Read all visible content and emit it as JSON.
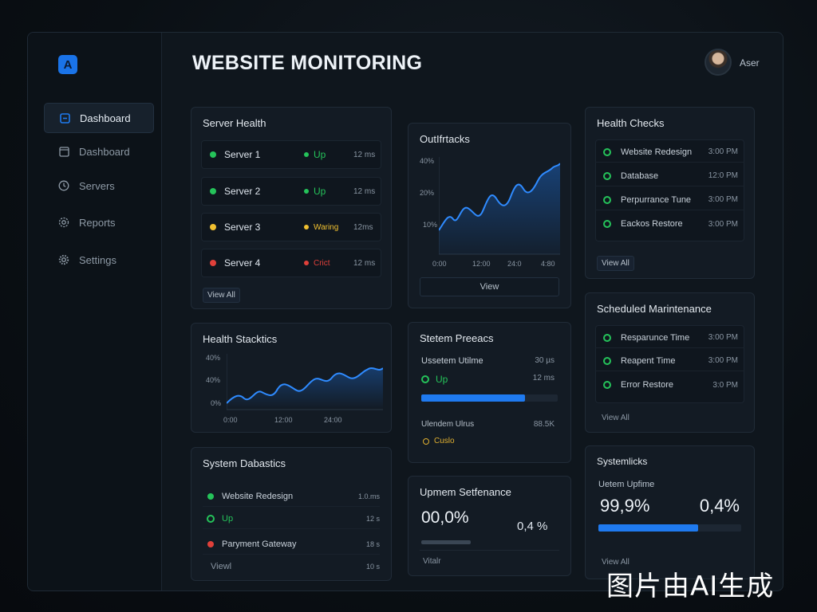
{
  "header": {
    "title": "WEBSITE MONITORING",
    "username": "Aser",
    "logo_letter": "A"
  },
  "sidebar": {
    "items": [
      {
        "label": "Dashboard",
        "icon": "dashboard-icon",
        "active": true
      },
      {
        "label": "Dashboard",
        "icon": "window-icon",
        "active": false
      },
      {
        "label": "Servers",
        "icon": "clock-icon",
        "active": false
      },
      {
        "label": "Reports",
        "icon": "gear-small-icon",
        "active": false
      },
      {
        "label": "Settings",
        "icon": "gear-icon",
        "active": false
      }
    ]
  },
  "server_health": {
    "title": "Server Health",
    "servers": [
      {
        "name": "Server 1",
        "status": "Up",
        "latency": "12 ms",
        "color": "#25c35a"
      },
      {
        "name": "Server 2",
        "status": "Up",
        "latency": "12 ms",
        "color": "#25c35a"
      },
      {
        "name": "Server 3",
        "status": "Waring",
        "latency": "12ms",
        "color": "#f0c030"
      },
      {
        "name": "Server 4",
        "status": "Crict",
        "latency": "12 ms",
        "color": "#e0403a"
      }
    ],
    "view_all": "View All"
  },
  "health_stats": {
    "title": "Health Stacktics",
    "y_ticks": [
      "40%",
      "40%",
      "0%"
    ],
    "x_ticks": [
      "0:00",
      "12:00",
      "24:00"
    ]
  },
  "system_diag": {
    "title": "System Dabastics",
    "rows": [
      {
        "label": "Website Redesign",
        "value": "1.0.ms",
        "marker": "dot",
        "color": "#25c35a"
      },
      {
        "label": "Up",
        "value": "12 s",
        "marker": "ring",
        "color": "#25c35a"
      },
      {
        "label": "Paryment Gateway",
        "value": "18 s",
        "marker": "dot",
        "color": "#e0403a"
      },
      {
        "label": "Viewl",
        "value": "10 s",
        "marker": "none",
        "color": "#8a96a3"
      }
    ]
  },
  "outchecks": {
    "title": "OutIfrtacks",
    "y_ticks": [
      "40%",
      "20%",
      "10%"
    ],
    "x_ticks": [
      "0:00",
      "12:00",
      "24:0",
      "4:80"
    ],
    "view": "View"
  },
  "system_prefs": {
    "title": "Stetem Preeacs",
    "uptime_label": "Ussetem Utilme",
    "uptime_value": "30 µs",
    "up_label": "Up",
    "up_value": "12 ms",
    "progress": 0.76,
    "second_label": "Ulendem Ulrus",
    "second_value": "88.5K",
    "warn_label": "Cuslo"
  },
  "uptime_status": {
    "title": "Upmem Setfenance",
    "big_value": "00,0%",
    "small_value": "0,4 %",
    "progress": 0.36,
    "view": "Vitalr"
  },
  "health_checks": {
    "title": "Health Checks",
    "items": [
      {
        "label": "Website Redesign",
        "time": "3:00 PM"
      },
      {
        "label": "Database",
        "time": "12:0 PM"
      },
      {
        "label": "Perpurrance Tune",
        "time": "3:00 PM"
      },
      {
        "label": "Eackos Restore",
        "time": "3:00 PM"
      }
    ],
    "view_all": "View All"
  },
  "maintenance": {
    "title": "Scheduled Marintenance",
    "items": [
      {
        "label": "Resparunce Time",
        "time": "3:00 PM"
      },
      {
        "label": "Reapent Time",
        "time": "3:00 PM"
      },
      {
        "label": "Error Restore",
        "time": "3:0 PM"
      }
    ],
    "view_all": "View All"
  },
  "system_checks": {
    "title": "Systemlicks",
    "subtitle": "Uetem Upfime",
    "value_left": "99,9%",
    "value_right": "0,4%",
    "progress": 0.7,
    "view_all": "View All"
  },
  "watermark": "图片由AI生成"
}
